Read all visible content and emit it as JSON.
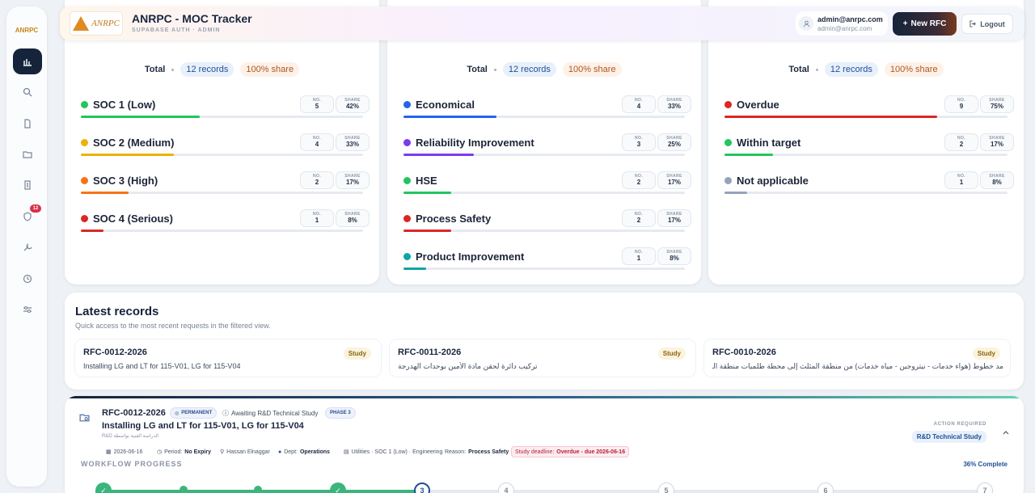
{
  "header": {
    "logo_text": "ANRPC",
    "title": "ANRPC - MOC Tracker",
    "subtitle": "SUPABASE AUTH · ADMIN",
    "user_name": "admin@anrpc.com",
    "user_email": "admin@anrpc.com",
    "new_button": "New RFC",
    "logout_button": "Logout"
  },
  "sidebar": {
    "logo_text": "ANRPC",
    "items": [
      {
        "icon": "chart-icon",
        "active": true
      },
      {
        "icon": "search-icon",
        "active": false
      },
      {
        "icon": "document-icon",
        "active": false
      },
      {
        "icon": "folder-icon",
        "active": false
      },
      {
        "icon": "file-icon",
        "active": false
      },
      {
        "icon": "shield-icon",
        "active": false,
        "badge": "12"
      },
      {
        "icon": "wrench-icon",
        "active": false
      },
      {
        "icon": "clock-icon",
        "active": false
      },
      {
        "icon": "sliders-icon",
        "active": false
      }
    ]
  },
  "panels": [
    {
      "total_label": "Total",
      "records": "12 records",
      "share": "100% share",
      "rows": [
        {
          "name": "SOC 1 (Low)",
          "color": "#22c55e",
          "no": "5",
          "share": "42%",
          "pct": 42
        },
        {
          "name": "SOC 2 (Medium)",
          "color": "#eab308",
          "no": "4",
          "share": "33%",
          "pct": 33
        },
        {
          "name": "SOC 3 (High)",
          "color": "#f97316",
          "no": "2",
          "share": "17%",
          "pct": 17
        },
        {
          "name": "SOC 4 (Serious)",
          "color": "#dc2626",
          "no": "1",
          "share": "8%",
          "pct": 8
        }
      ]
    },
    {
      "total_label": "Total",
      "records": "12 records",
      "share": "100% share",
      "rows": [
        {
          "name": "Economical",
          "color": "#2563eb",
          "no": "4",
          "share": "33%",
          "pct": 33
        },
        {
          "name": "Reliability Improvement",
          "color": "#7c3aed",
          "no": "3",
          "share": "25%",
          "pct": 25
        },
        {
          "name": "HSE",
          "color": "#22c55e",
          "no": "2",
          "share": "17%",
          "pct": 17
        },
        {
          "name": "Process Safety",
          "color": "#dc2626",
          "no": "2",
          "share": "17%",
          "pct": 17
        },
        {
          "name": "Product Improvement",
          "color": "#0ea5a5",
          "no": "1",
          "share": "8%",
          "pct": 8
        }
      ]
    },
    {
      "total_label": "Total",
      "records": "12 records",
      "share": "100% share",
      "rows": [
        {
          "name": "Overdue",
          "color": "#dc2626",
          "no": "9",
          "share": "75%",
          "pct": 75
        },
        {
          "name": "Within target",
          "color": "#22c55e",
          "no": "2",
          "share": "17%",
          "pct": 17
        },
        {
          "name": "Not applicable",
          "color": "#94a3b8",
          "no": "1",
          "share": "8%",
          "pct": 8
        }
      ]
    }
  ],
  "stat_labels": {
    "no": "NO.",
    "share": "SHARE"
  },
  "latest": {
    "title": "Latest records",
    "hint": "Quick access to the most recent requests in the filtered view.",
    "records": [
      {
        "id": "RFC-0012-2026",
        "desc": "Installing LG and LT for 115-V01, LG for 115-V04",
        "tag": "Study"
      },
      {
        "id": "RFC-0011-2026",
        "desc": "تركيب دائرة لحقن مادة الأمين بوحدات الهدرجة",
        "tag": "Study"
      },
      {
        "id": "RFC-0010-2026",
        "desc": "مد خطوط (هواء خدمات - نيتروجين - مياه خدمات) من منطقة المثلث إلى محطة طلمبات منطقة المستكثفات",
        "tag": "Study"
      }
    ]
  },
  "detail": {
    "id": "RFC-0012-2026",
    "tag_permanent": "PERMANENT",
    "tag_awaiting": "Awaiting R&D Technical Study",
    "tag_phase": "PHASE 3",
    "title": "Installing LG and LT for 115-V01, LG for 115-V04",
    "subtitle": "R&D الدراسة الفنية بواسطة",
    "meta_date": "2026-06-16",
    "meta_period_label": "Period:",
    "meta_period_value": "No Expiry",
    "meta_user": "Hassan Elnaggar",
    "meta_dept_label": "Dept:",
    "meta_dept_value": "Operations",
    "meta_scope": "Utilities · SOC 1 (Low) · Engineering",
    "meta_reason_label": "Reason:",
    "meta_reason_value": "Process Safety",
    "meta_deadline_label": "Study deadline:",
    "meta_deadline_value": "Overdue - due 2026-06-16",
    "action_label": "ACTION REQUIRED",
    "action_value": "R&D Technical Study",
    "workflow_label": "WORKFLOW PROGRESS",
    "workflow_pct": "36% Complete",
    "progress": 36,
    "steps": [
      "3",
      "4",
      "5",
      "6",
      "7"
    ]
  }
}
